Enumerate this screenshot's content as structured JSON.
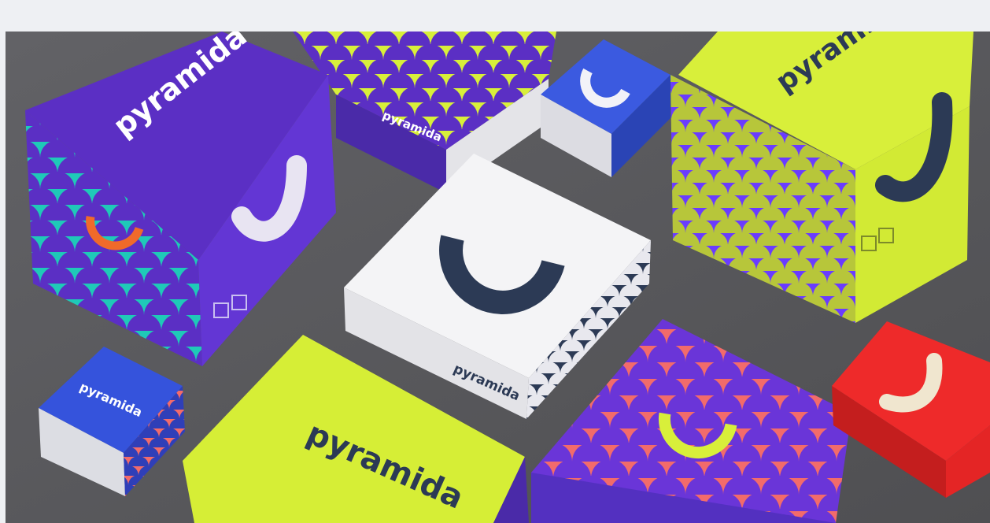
{
  "image": {
    "caption": "",
    "colors": {
      "frame": "#eef0f3",
      "floor": "#5c5c5f",
      "purple": "#5b2fc4",
      "lime": "#d8ef3a",
      "teal": "#1fc9b8",
      "blue": "#2f4fd0",
      "white": "#f4f4f4",
      "navy": "#2c3a55",
      "coral": "#f26b6b",
      "red": "#ee2a2a",
      "cream": "#f0e6cf"
    },
    "brand": {
      "wordmark": "pyramida"
    },
    "icons": [
      "smile-arc-icon"
    ]
  }
}
